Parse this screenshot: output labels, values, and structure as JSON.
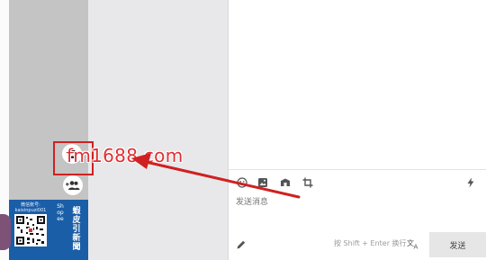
{
  "composer": {
    "placeholder": "发送消息",
    "hint": "按 Shift + Enter 换行",
    "send_label": "发送"
  },
  "promo": {
    "account_label": "微信账号:",
    "account_id": "kaixinpuzi001",
    "vertical_brand": "Shopee",
    "vertical_slogan": "蝦皮引新聞"
  },
  "watermark": "fm1688.com",
  "colors": {
    "annotation_red": "#cf2121",
    "promo_blue": "#1a5ea8"
  },
  "icons": {
    "toolbar": [
      "emoji-icon",
      "image-icon",
      "product-icon",
      "crop-icon",
      "lightning-icon"
    ],
    "sidebar": [
      "add-contact-icon",
      "add-group-icon"
    ],
    "composer": [
      "edit-icon",
      "translate-icon"
    ]
  }
}
